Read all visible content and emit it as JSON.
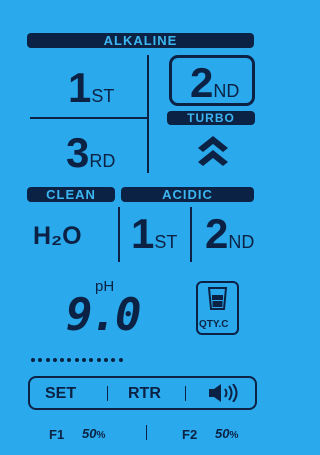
{
  "alkaline": {
    "label": "ALKALINE",
    "first_num": "1",
    "first_suffix": "ST",
    "second_num": "2",
    "second_suffix": "ND",
    "third_num": "3",
    "third_suffix": "RD"
  },
  "turbo": {
    "label": "TURBO",
    "icon": "double-chevron-up-icon"
  },
  "clean": {
    "label": "CLEAN",
    "h2o": "H₂O"
  },
  "acidic": {
    "label": "ACIDIC",
    "first_num": "1",
    "first_suffix": "ST",
    "second_num": "2",
    "second_suffix": "ND"
  },
  "ph": {
    "label": "pH",
    "value": "9.0",
    "dots": 13
  },
  "qty": {
    "label": "QTY.C",
    "icon": "cup-icon"
  },
  "controls": {
    "set": "SET",
    "rtr": "RTR",
    "sound_icon": "speaker-icon"
  },
  "filters": {
    "f1_label": "F1",
    "f1_value": "50",
    "f1_unit": "%",
    "f2_label": "F2",
    "f2_value": "50",
    "f2_unit": "%"
  },
  "colors": {
    "background": "#2aa9ec",
    "ink": "#0c2244",
    "pill_text": "#3cb6f2"
  }
}
